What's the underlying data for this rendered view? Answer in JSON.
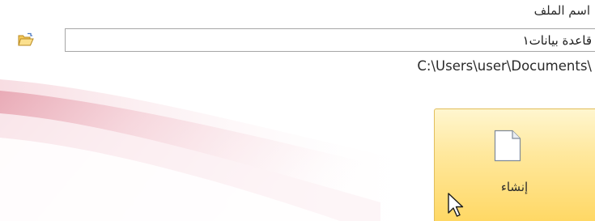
{
  "file_name": {
    "label": "اسم الملف",
    "value": "قاعدة بيانات١",
    "browse_icon": "folder-open-icon"
  },
  "save_path": "C:\\Users\\user\\Documents\\",
  "create_button": {
    "label": "إنشاء",
    "icon": "blank-document-icon"
  },
  "colors": {
    "button_fill_top": "#fff6cf",
    "button_fill_bottom": "#ffd865",
    "button_border": "#e1be5c",
    "accent_swoosh": "#e8a8b4"
  }
}
